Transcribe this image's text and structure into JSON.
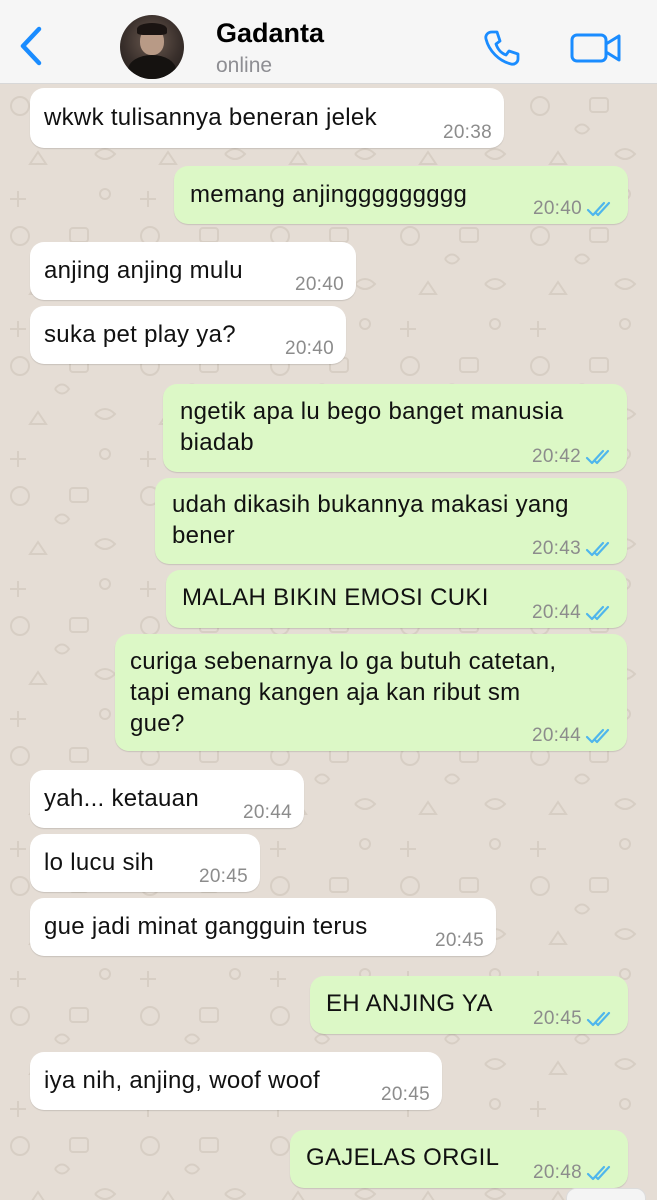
{
  "header": {
    "contact_name": "Gadanta",
    "status": "online"
  },
  "colors": {
    "accent": "#1a8cff",
    "incoming_bubble": "#ffffff",
    "outgoing_bubble": "#dcf8c6",
    "wallpaper": "#e5ddd5",
    "read_ticks": "#4fb6ec"
  },
  "icons": {
    "back": "chevron-left-icon",
    "call": "phone-icon",
    "video": "video-camera-icon",
    "read": "double-check-icon"
  },
  "messages": [
    {
      "direction": "in",
      "lines": [
        "wkwk tulisannya beneran jelek"
      ],
      "time": "20:38"
    },
    {
      "direction": "out",
      "lines": [
        "memang anjinggggggggg"
      ],
      "time": "20:40",
      "read": true
    },
    {
      "direction": "in",
      "lines": [
        "anjing anjing mulu"
      ],
      "time": "20:40"
    },
    {
      "direction": "in",
      "lines": [
        "suka pet play ya?"
      ],
      "time": "20:40"
    },
    {
      "direction": "out",
      "lines": [
        "ngetik apa lu bego banget manusia",
        "biadab"
      ],
      "time": "20:42",
      "read": true
    },
    {
      "direction": "out",
      "lines": [
        "udah dikasih bukannya makasi yang",
        "bener"
      ],
      "time": "20:43",
      "read": true
    },
    {
      "direction": "out",
      "lines": [
        "MALAH BIKIN EMOSI CUKI"
      ],
      "time": "20:44",
      "read": true
    },
    {
      "direction": "out",
      "lines": [
        "curiga sebenarnya lo ga butuh catetan,",
        "tapi emang kangen aja kan ribut sm",
        "gue?"
      ],
      "time": "20:44",
      "read": true
    },
    {
      "direction": "in",
      "lines": [
        "yah... ketauan"
      ],
      "time": "20:44"
    },
    {
      "direction": "in",
      "lines": [
        "lo lucu sih"
      ],
      "time": "20:45"
    },
    {
      "direction": "in",
      "lines": [
        "gue jadi minat gangguin terus"
      ],
      "time": "20:45"
    },
    {
      "direction": "out",
      "lines": [
        "EH ANJING YA"
      ],
      "time": "20:45",
      "read": true
    },
    {
      "direction": "in",
      "lines": [
        "iya nih, anjing, woof woof"
      ],
      "time": "20:45"
    },
    {
      "direction": "out",
      "lines": [
        "GAJELAS ORGIL"
      ],
      "time": "20:48",
      "read": true
    }
  ]
}
